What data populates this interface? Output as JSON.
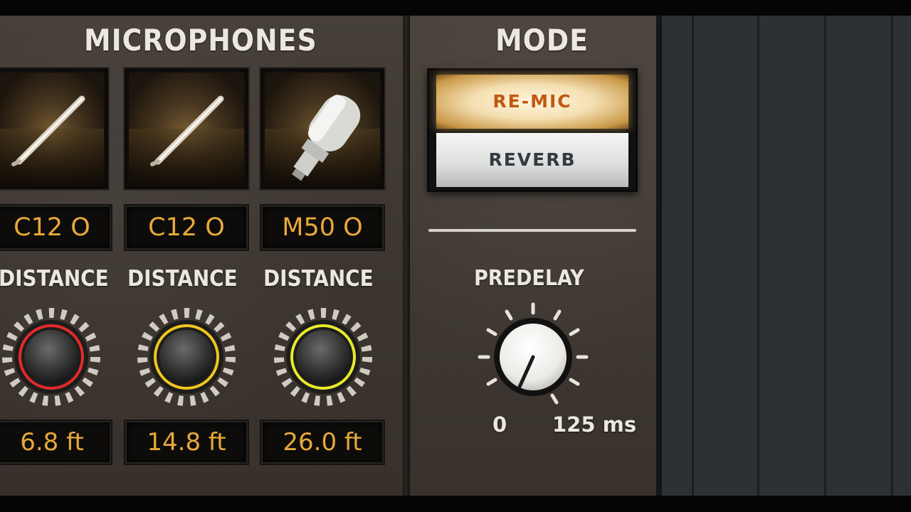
{
  "microphones": {
    "title": "MICROPHONES",
    "channels": [
      {
        "mic_model": "C12 O",
        "distance_label": "DISTANCE",
        "distance_value": "6.8 ft",
        "ring_color": "#e52a2a",
        "mic_icon": "ribbon-mic-icon"
      },
      {
        "mic_model": "C12 O",
        "distance_label": "DISTANCE",
        "distance_value": "14.8 ft",
        "ring_color": "#f0c51e",
        "mic_icon": "ribbon-mic-icon"
      },
      {
        "mic_model": "M50 O",
        "distance_label": "DISTANCE",
        "distance_value": "26.0 ft",
        "ring_color": "#e9ea2a",
        "mic_icon": "condenser-mic-icon"
      }
    ]
  },
  "mode": {
    "title": "MODE",
    "options": [
      "RE-MIC",
      "REVERB"
    ],
    "selected": "RE-MIC",
    "active_color": "#c1580f"
  },
  "predelay": {
    "label": "PREDELAY",
    "min_label": "0",
    "max_label": "125 ms"
  }
}
